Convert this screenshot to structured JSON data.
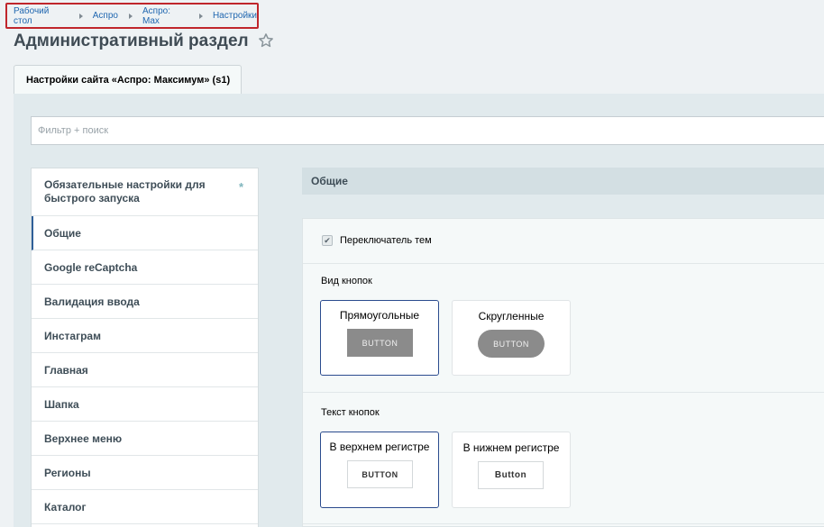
{
  "breadcrumb": [
    "Рабочий стол",
    "Аспро",
    "Аспро: Max",
    "Настройки"
  ],
  "page_title": "Административный раздел",
  "tab_label": "Настройки сайта «Аспро: Максимум» (s1)",
  "filter_placeholder": "Фильтр + поиск",
  "menu": {
    "first": "Обязательные настройки для быстрого запуска",
    "required_mark": "*",
    "items": [
      "Общие",
      "Google reCaptcha",
      "Валидация ввода",
      "Инстаграм",
      "Главная",
      "Шапка",
      "Верхнее меню",
      "Регионы",
      "Каталог"
    ],
    "active": "Общие"
  },
  "section": {
    "title": "Общие",
    "theme_switch_label": "Переключатель тем",
    "theme_switch_checked": true,
    "button_style": {
      "label": "Вид кнопок",
      "options": [
        {
          "title": "Прямоугольные",
          "sample": "BUTTON",
          "selected": true
        },
        {
          "title": "Скругленные",
          "sample": "BUTTON",
          "selected": false
        }
      ]
    },
    "button_text": {
      "label": "Текст кнопок",
      "options": [
        {
          "title": "В верхнем регистре",
          "sample": "BUTTON",
          "selected": true
        },
        {
          "title": "В нижнем регистре",
          "sample": "Button",
          "selected": false
        }
      ]
    }
  },
  "colors": {
    "accent": "#2b4b8e",
    "breadcrumb_highlight": "#c0262c",
    "link": "#2067b0"
  },
  "icons": {
    "favorite": "star-icon",
    "check": "checkmark-icon"
  }
}
